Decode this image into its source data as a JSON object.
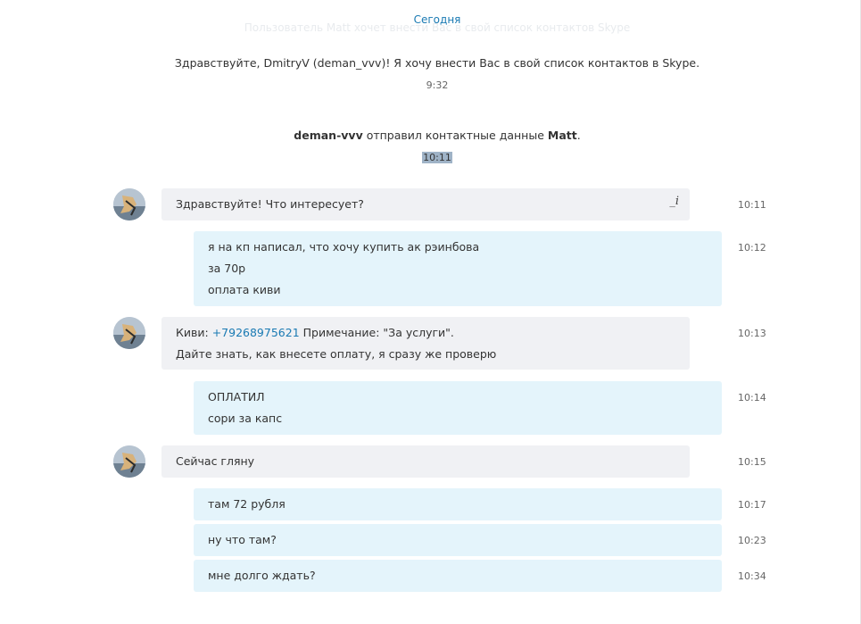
{
  "header": {
    "day_label": "Сегодня",
    "faded_request": "Пользователь Matt хочет внести Вас в свой список контактов Skype"
  },
  "system": {
    "invite_text": "Здравствуйте, DmitryV (deman_vvv)! Я хочу внести Вас в свой список контактов в Skype.",
    "invite_time": "9:32",
    "contact_sent_user": "deman-vvv",
    "contact_sent_text": " отправил контактные данные ",
    "contact_sent_name": "Matt",
    "contact_sent_end": ".",
    "contact_sent_time": "10:11"
  },
  "messages": [
    {
      "dir": "in",
      "lines": [
        "Здравствуйте! Что интересует?"
      ],
      "time": "10:11",
      "edit_icon": "edit-icon"
    },
    {
      "dir": "out",
      "lines": [
        "я на кп написал, что хочу купить ак рэинбова",
        "за 70р",
        "оплата киви"
      ],
      "time": "10:12"
    },
    {
      "dir": "in",
      "line1_prefix": "Киви: ",
      "line1_link": "+79268975621",
      "line1_suffix": " Примечание: \"За услуги\".",
      "line2": "Дайте знать, как внесете оплату, я сразу же проверю",
      "time": "10:13"
    },
    {
      "dir": "out",
      "lines": [
        "ОПЛАТИЛ",
        "сори за капс"
      ],
      "time": "10:14"
    },
    {
      "dir": "in",
      "lines": [
        "Сейчас гляну"
      ],
      "time": "10:15"
    },
    {
      "dir": "out",
      "lines": [
        "там 72 рубля"
      ],
      "time": "10:17"
    },
    {
      "dir": "out",
      "lines": [
        "ну что там?"
      ],
      "time": "10:23"
    },
    {
      "dir": "out",
      "lines": [
        "мне долго ждать?"
      ],
      "time": "10:34"
    }
  ]
}
